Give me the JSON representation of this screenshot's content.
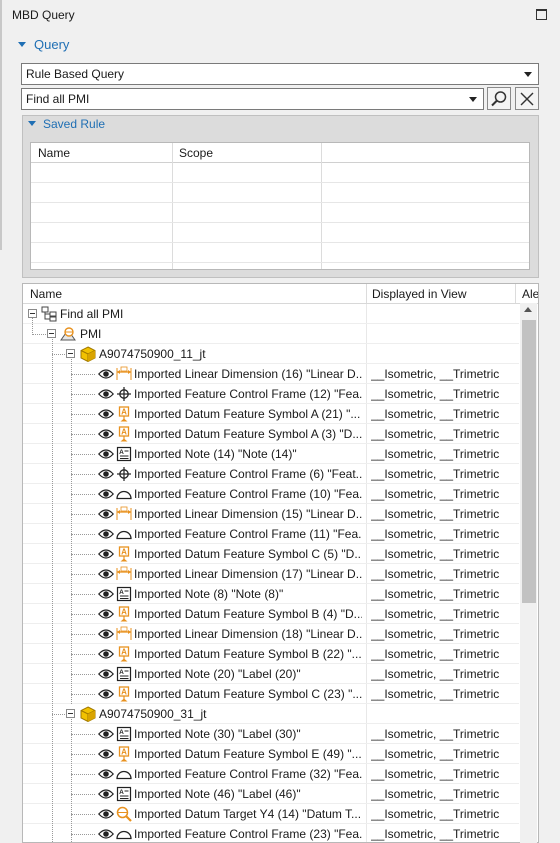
{
  "panel": {
    "title": "MBD Query"
  },
  "query_section": {
    "label": "Query"
  },
  "query_type": {
    "value": "Rule Based Query"
  },
  "rule_select": {
    "value": "Find all PMI"
  },
  "saved_rule": {
    "label": "Saved Rule",
    "columns": [
      "Name",
      "Scope"
    ]
  },
  "tree": {
    "columns": [
      "Name",
      "Displayed in View",
      "Ale"
    ],
    "root": "Find all PMI",
    "pmi": "PMI",
    "groups": [
      {
        "name": "A9074750900_11_jt",
        "items": [
          {
            "name": "Imported Linear Dimension (16) \"Linear D...",
            "view": "__Isometric, __Trimetric",
            "icon": "linear-dimension-icon"
          },
          {
            "name": "Imported Feature Control Frame (12) \"Fea...",
            "view": "__Isometric, __Trimetric",
            "icon": "position-fcf-icon"
          },
          {
            "name": "Imported Datum Feature Symbol A (21) \"...",
            "view": "__Isometric, __Trimetric",
            "icon": "datum-feature-icon"
          },
          {
            "name": "Imported Datum Feature Symbol A (3) \"D...",
            "view": "__Isometric, __Trimetric",
            "icon": "datum-feature-icon"
          },
          {
            "name": "Imported Note (14) \"Note (14)\"",
            "view": "__Isometric, __Trimetric",
            "icon": "note-icon"
          },
          {
            "name": "Imported Feature Control Frame (6) \"Feat...",
            "view": "__Isometric, __Trimetric",
            "icon": "position-fcf-icon"
          },
          {
            "name": "Imported Feature Control Frame (10) \"Fea...",
            "view": "__Isometric, __Trimetric",
            "icon": "profile-fcf-icon"
          },
          {
            "name": "Imported Linear Dimension (15) \"Linear D...",
            "view": "__Isometric, __Trimetric",
            "icon": "linear-dimension-icon"
          },
          {
            "name": "Imported Feature Control Frame (11) \"Fea...",
            "view": "__Isometric, __Trimetric",
            "icon": "profile-fcf-icon"
          },
          {
            "name": "Imported Datum Feature Symbol C (5) \"D...",
            "view": "__Isometric, __Trimetric",
            "icon": "datum-feature-icon"
          },
          {
            "name": "Imported Linear Dimension (17) \"Linear D...",
            "view": "__Isometric, __Trimetric",
            "icon": "linear-dimension-icon"
          },
          {
            "name": "Imported Note (8) \"Note (8)\"",
            "view": "__Isometric, __Trimetric",
            "icon": "note-icon"
          },
          {
            "name": "Imported Datum Feature Symbol B (4) \"D...",
            "view": "__Isometric, __Trimetric",
            "icon": "datum-feature-icon"
          },
          {
            "name": "Imported Linear Dimension (18) \"Linear D...",
            "view": "__Isometric, __Trimetric",
            "icon": "linear-dimension-icon"
          },
          {
            "name": "Imported Datum Feature Symbol B (22) \"...",
            "view": "__Isometric, __Trimetric",
            "icon": "datum-feature-icon"
          },
          {
            "name": "Imported Note (20) \"Label (20)\"",
            "view": "__Isometric, __Trimetric",
            "icon": "note-icon"
          },
          {
            "name": "Imported Datum Feature Symbol C (23) \"...",
            "view": "__Isometric, __Trimetric",
            "icon": "datum-feature-icon"
          }
        ]
      },
      {
        "name": "A9074750900_31_jt",
        "items": [
          {
            "name": "Imported Note (30) \"Label (30)\"",
            "view": "__Isometric, __Trimetric",
            "icon": "note-icon"
          },
          {
            "name": "Imported Datum Feature Symbol E (49) \"...",
            "view": "__Isometric, __Trimetric",
            "icon": "datum-feature-icon"
          },
          {
            "name": "Imported Feature Control Frame (32) \"Fea...",
            "view": "__Isometric, __Trimetric",
            "icon": "profile-fcf-icon"
          },
          {
            "name": "Imported Note (46) \"Label (46)\"",
            "view": "__Isometric, __Trimetric",
            "icon": "note-icon"
          },
          {
            "name": "Imported Datum Target Y4 (14) \"Datum T...",
            "view": "__Isometric, __Trimetric",
            "icon": "datum-target-icon"
          },
          {
            "name": "Imported Feature Control Frame (23) \"Fea...",
            "view": "__Isometric, __Trimetric",
            "icon": "profile-fcf-icon"
          }
        ]
      }
    ]
  },
  "colors": {
    "accent": "#1f6fb4",
    "icon_orange": "#e8911e",
    "assembly_yellow": "#e8b800"
  }
}
